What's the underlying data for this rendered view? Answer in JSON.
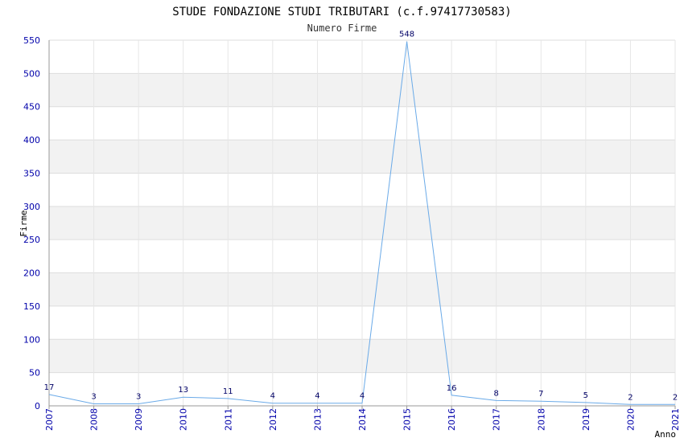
{
  "chart_data": {
    "type": "line",
    "title": "STUDE FONDAZIONE STUDI TRIBUTARI (c.f.97417730583)",
    "subtitle": "Numero Firme",
    "xlabel": "Anno",
    "ylabel": "Firme",
    "x": [
      "2007",
      "2008",
      "2009",
      "2010",
      "2011",
      "2012",
      "2013",
      "2014",
      "2015",
      "2016",
      "2017",
      "2018",
      "2019",
      "2020",
      "2021"
    ],
    "series": [
      {
        "values": [
          17,
          3,
          3,
          13,
          11,
          4,
          4,
          4,
          548,
          16,
          8,
          7,
          5,
          2,
          2
        ]
      }
    ],
    "data_labels": [
      "17",
      "3",
      "3",
      "13",
      "11",
      "4",
      "4",
      "4",
      "548",
      "16",
      "8",
      "7",
      "5",
      "2",
      "2"
    ],
    "ylim": [
      0,
      550
    ],
    "yticks": [
      "0",
      "50",
      "100",
      "150",
      "200",
      "250",
      "300",
      "350",
      "400",
      "450",
      "500",
      "550"
    ],
    "grid": true,
    "legend": "none",
    "colors": {
      "line": "#6aaae8",
      "band_alt": "#f2f2f2",
      "band": "#ffffff",
      "tick_text": "#0000aa",
      "data_label": "#000066"
    }
  }
}
